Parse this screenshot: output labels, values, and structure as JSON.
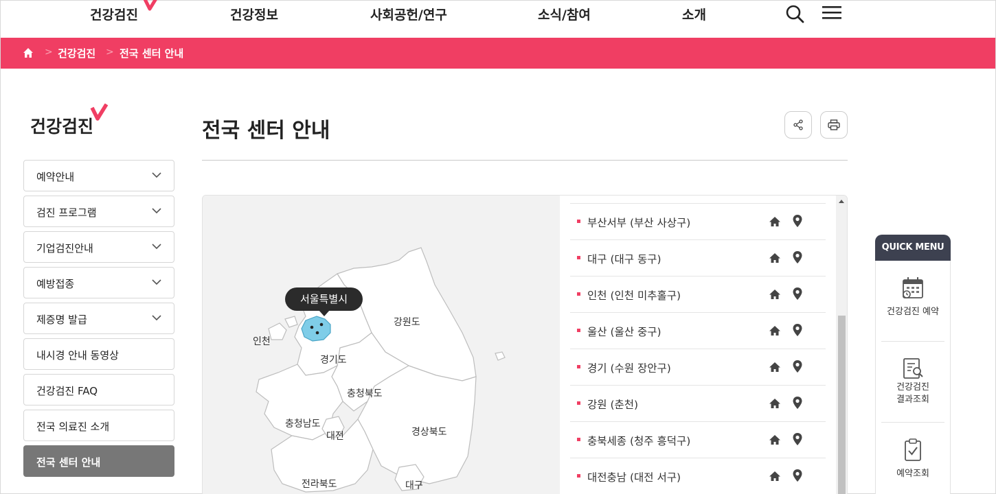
{
  "nav": {
    "items": [
      "건강검진",
      "건강정보",
      "사회공헌/연구",
      "소식/참여",
      "소개"
    ]
  },
  "breadcrumb": {
    "items": [
      "건강검진",
      "전국 센터 안내"
    ]
  },
  "sidebar": {
    "title": "건강검진",
    "items": [
      {
        "label": "예약안내",
        "expandable": true
      },
      {
        "label": "검진 프로그램",
        "expandable": true
      },
      {
        "label": "기업검진안내",
        "expandable": true
      },
      {
        "label": "예방접종",
        "expandable": true
      },
      {
        "label": "제증명 발급",
        "expandable": true
      },
      {
        "label": "내시경 안내 동영상",
        "expandable": false
      },
      {
        "label": "건강검진 FAQ",
        "expandable": false
      },
      {
        "label": "전국 의료진 소개",
        "expandable": false
      },
      {
        "label": "전국 센터 안내",
        "expandable": false,
        "active": true
      }
    ]
  },
  "main": {
    "title": "전국 센터 안내"
  },
  "map": {
    "tooltip": "서울특별시",
    "regions": [
      "인천",
      "강원도",
      "경기도",
      "충청북도",
      "충청남도",
      "대전",
      "경상북도",
      "전라북도",
      "대구"
    ]
  },
  "centers": [
    {
      "name": "부산서부 (부산 사상구)"
    },
    {
      "name": "대구 (대구 동구)"
    },
    {
      "name": "인천 (인천 미추홀구)"
    },
    {
      "name": "울산 (울산 중구)"
    },
    {
      "name": "경기 (수원 장안구)"
    },
    {
      "name": "강원 (춘천)"
    },
    {
      "name": "충북세종 (청주 흥덕구)"
    },
    {
      "name": "대전충남 (대전 서구)"
    }
  ],
  "quick_menu": {
    "title": "QUICK MENU",
    "items": [
      {
        "label": "건강검진 예약",
        "icon": "calendar-icon"
      },
      {
        "label": "건강검진\n결과조회",
        "icon": "document-search-icon"
      },
      {
        "label": "예약조회",
        "icon": "clipboard-check-icon"
      }
    ]
  },
  "colors": {
    "accent": "#f03e63",
    "quick_header": "#3d4150",
    "active_menu": "#777777",
    "seoul_marker": "#7fcde8"
  }
}
